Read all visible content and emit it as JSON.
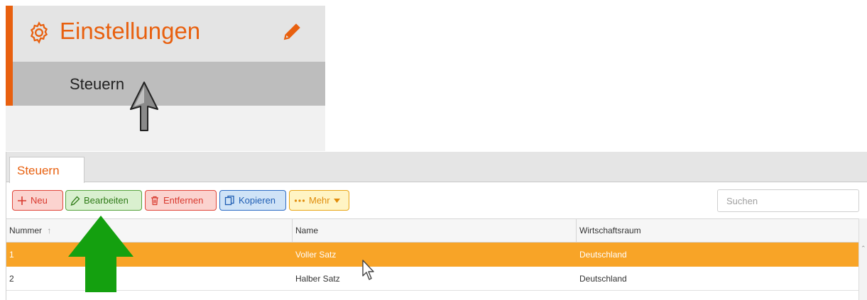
{
  "menu": {
    "title": "Einstellungen",
    "gear_icon": "gear-icon",
    "edit_icon": "pencil-icon",
    "item_label": "Steuern",
    "accent_color": "#e8600f"
  },
  "tabs": [
    {
      "label": "Steuern"
    }
  ],
  "toolbar": {
    "new_label": "Neu",
    "edit_label": "Bearbeiten",
    "delete_label": "Entfernen",
    "copy_label": "Kopieren",
    "more_label": "Mehr",
    "search_placeholder": "Suchen"
  },
  "grid": {
    "columns": [
      "Nummer",
      "Name",
      "Wirtschaftsraum"
    ],
    "sort_indicator": "↑",
    "rows": [
      {
        "nummer": "1",
        "name": "Voller Satz",
        "wirtschaftsraum": "Deutschland",
        "selected": true
      },
      {
        "nummer": "2",
        "name": "Halber Satz",
        "wirtschaftsraum": "Deutschland",
        "selected": false
      }
    ],
    "selection_color": "#f8a427"
  },
  "annotations": {
    "arrow_color": "#14a00f"
  }
}
